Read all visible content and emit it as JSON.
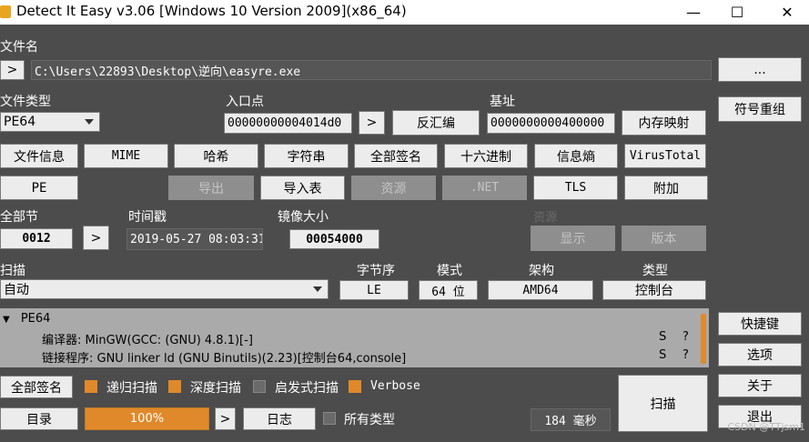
{
  "window": {
    "title": "Detect It Easy v3.06 [Windows 10 Version 2009](x86_64)",
    "minimize": "—",
    "maximize": "☐",
    "close": "✕"
  },
  "file": {
    "label": "文件名",
    "path": "C:\\Users\\22893\\Desktop\\逆向\\easyre.exe",
    "expand": ">",
    "browse": "..."
  },
  "filetype": {
    "label": "文件类型",
    "value": "PE64"
  },
  "entry": {
    "label": "入口点",
    "value": "00000000004014d0",
    "go": ">",
    "disasm": "反汇编"
  },
  "base": {
    "label": "基址",
    "value": "0000000000400000",
    "memmap": "内存映射"
  },
  "side": {
    "symbols": "符号重组",
    "shortcuts": "快捷键",
    "options": "选项",
    "about": "关于",
    "exit": "退出"
  },
  "row1": [
    "文件信息",
    "MIME",
    "哈希",
    "字符串",
    "全部签名",
    "十六进制",
    "信息熵",
    "VirusTotal"
  ],
  "row2": {
    "pe": "PE",
    "export": "导出",
    "import": "导入表",
    "resources": "资源",
    "net": ".NET",
    "tls": "TLS",
    "overlay": "附加"
  },
  "sections": {
    "label": "全部节",
    "value": "0012",
    "go": ">"
  },
  "timestamp": {
    "label": "时间戳",
    "value": "2019-05-27 08:03:31"
  },
  "imagesize": {
    "label": "镜像大小",
    "value": "00054000"
  },
  "resgroup": {
    "label": "资源",
    "show": "显示",
    "version": "版本"
  },
  "scan": {
    "label": "扫描",
    "mode": "自动"
  },
  "endian": {
    "label": "字节序",
    "value": "LE"
  },
  "mode": {
    "label": "模式",
    "value": "64 位"
  },
  "arch": {
    "label": "架构",
    "value": "AMD64"
  },
  "type": {
    "label": "类型",
    "value": "控制台"
  },
  "results": {
    "root": "PE64",
    "items": [
      {
        "text": "编译器: MinGW(GCC: (GNU) 4.8.1)[-]",
        "s": "S",
        "q": "?"
      },
      {
        "text": "链接程序: GNU linker ld (GNU Binutils)(2.23)[控制台64,console]",
        "s": "S",
        "q": "?"
      }
    ]
  },
  "bottom": {
    "allsig": "全部签名",
    "recursive": "递归扫描",
    "deep": "深度扫描",
    "heuristic": "启发式扫描",
    "verbose": "Verbose",
    "dir": "目录",
    "progress": "100%",
    "go": ">",
    "log": "日志",
    "alltypes": "所有类型",
    "time": "184 毫秒",
    "scan": "扫描"
  },
  "watermark": "CSDN @TTjsm1",
  "colors": {
    "accent": "#e0892a",
    "bg": "#4c4c4c"
  }
}
